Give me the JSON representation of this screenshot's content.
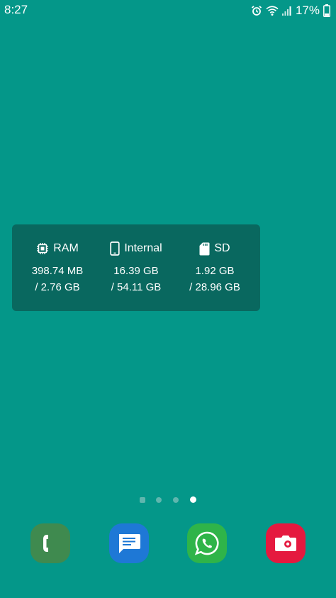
{
  "status_bar": {
    "time": "8:27",
    "battery": "17%",
    "icons": [
      "alarm-icon",
      "wifi-icon",
      "signal-icon"
    ]
  },
  "widget": {
    "columns": [
      {
        "icon": "chip-icon",
        "label": "RAM",
        "used": "398.74 MB",
        "total": "/ 2.76 GB"
      },
      {
        "icon": "phone-icon",
        "label": "Internal",
        "used": "16.39 GB",
        "total": "/ 54.11 GB"
      },
      {
        "icon": "sd-card-icon",
        "label": "SD",
        "used": "1.92 GB",
        "total": "/ 28.96 GB"
      }
    ]
  },
  "page_indicator": {
    "pages": 4,
    "current": 4
  },
  "dock": {
    "apps": [
      {
        "name": "phone",
        "icon": "phone-handset-icon",
        "color": "#3f8a4f"
      },
      {
        "name": "messages",
        "icon": "message-icon",
        "color": "#1e78d6"
      },
      {
        "name": "whatsapp",
        "icon": "whatsapp-icon",
        "color": "#2fb449"
      },
      {
        "name": "camera",
        "icon": "camera-icon",
        "color": "#e5193f"
      }
    ]
  },
  "colors": {
    "wallpaper": "#049789",
    "widget_background": "#09685f"
  }
}
